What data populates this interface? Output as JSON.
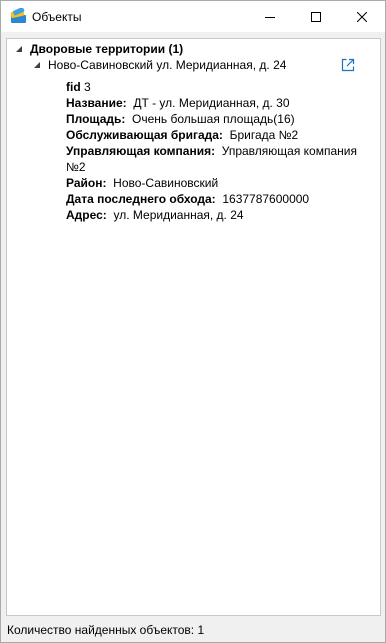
{
  "window": {
    "title": "Объекты"
  },
  "tree": {
    "root_label": "Дворовые территории (1)",
    "child_label": "Ново-Савиновский ул. Меридианная, д. 24"
  },
  "properties": [
    {
      "key": "fid",
      "value": "3"
    },
    {
      "key": "Название:",
      "value": "ДТ - ул. Меридианная, д. 30"
    },
    {
      "key": "Площадь:",
      "value": "Очень большая площадь(16)"
    },
    {
      "key": "Обслуживающая бригада:",
      "value": "Бригада №2"
    },
    {
      "key": "Управляющая компания:",
      "value": "Управляющая компания №2"
    },
    {
      "key": "Район:",
      "value": "Ново-Савиновский"
    },
    {
      "key": "Дата последнего обхода:",
      "value": "1637787600000"
    },
    {
      "key": "Адрес:",
      "value": "ул. Меридианная, д. 24"
    }
  ],
  "status": {
    "found_text": "Количество найденных объектов: 1"
  },
  "colors": {
    "accent": "#1e73be"
  }
}
